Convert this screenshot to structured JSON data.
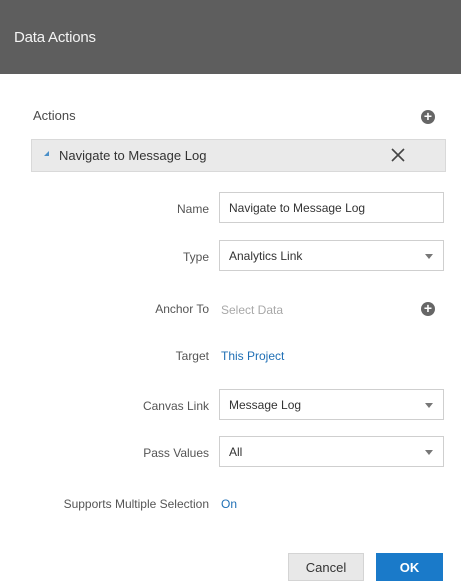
{
  "header": {
    "title": "Data Actions"
  },
  "actions": {
    "label": "Actions",
    "items": [
      {
        "label": "Navigate to Message Log"
      }
    ]
  },
  "form": {
    "name": {
      "label": "Name",
      "value": "Navigate to Message Log"
    },
    "type": {
      "label": "Type",
      "value": "Analytics Link"
    },
    "anchor_to": {
      "label": "Anchor To",
      "placeholder": "Select Data"
    },
    "target": {
      "label": "Target",
      "value": "This Project"
    },
    "canvas_link": {
      "label": "Canvas Link",
      "value": "Message Log"
    },
    "pass_values": {
      "label": "Pass Values",
      "value": "All"
    },
    "supports_multiple_selection": {
      "label": "Supports Multiple Selection",
      "value": "On"
    }
  },
  "footer": {
    "cancel_label": "Cancel",
    "ok_label": "OK"
  },
  "colors": {
    "header_bg": "#5e5e5e",
    "accent": "#1a7ac9",
    "link": "#1f6fb5"
  },
  "icons": {
    "add": "plus-circle-icon",
    "close": "close-icon",
    "expand": "expand-triangle-icon",
    "dropdown": "chevron-down-icon"
  }
}
